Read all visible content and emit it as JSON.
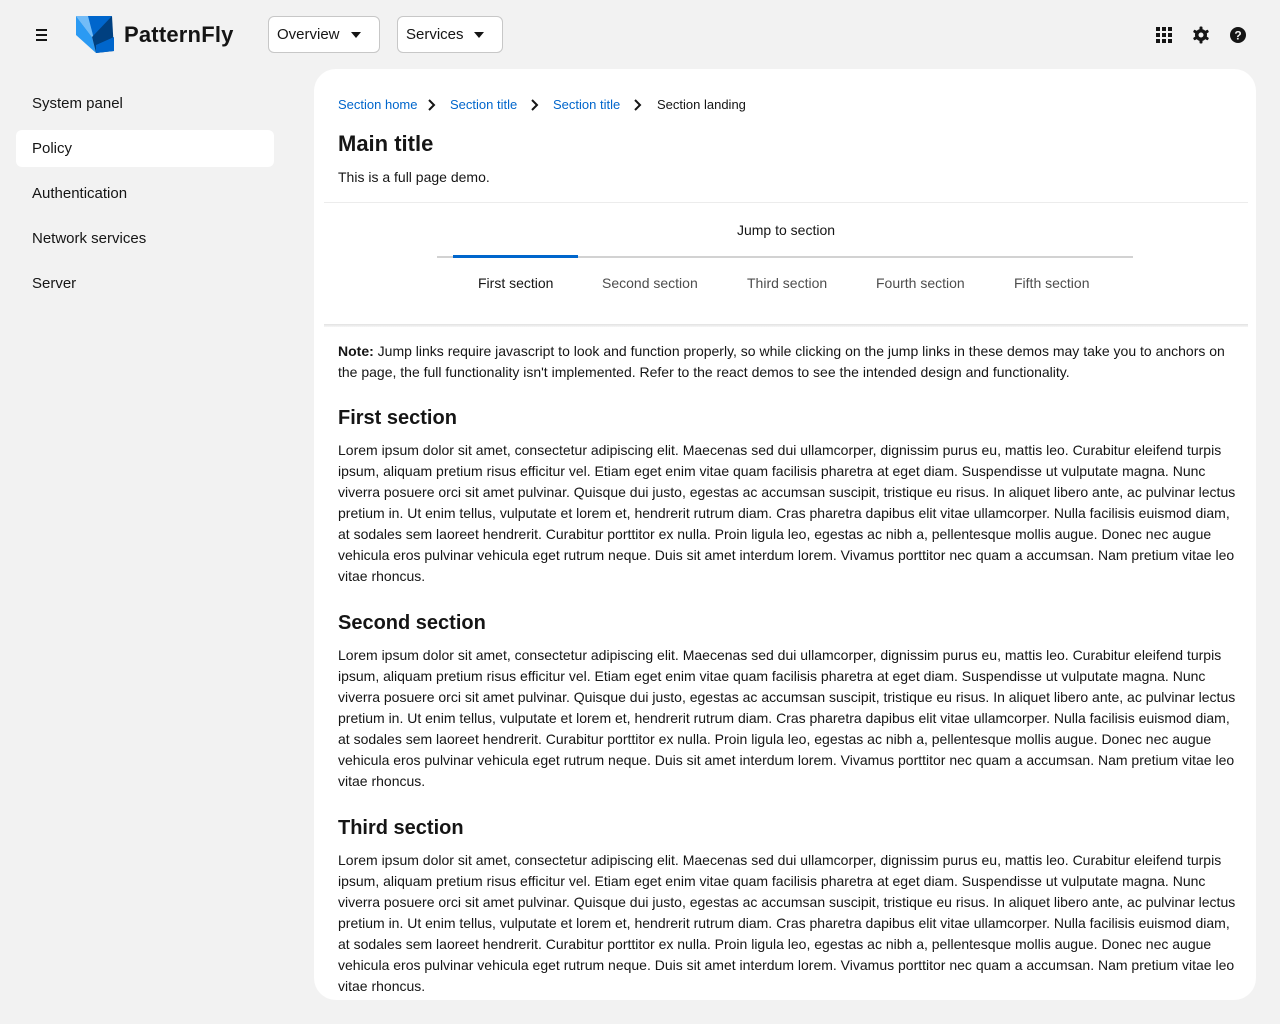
{
  "header": {
    "brand": "PatternFly",
    "selects": [
      {
        "label": "Overview"
      },
      {
        "label": "Services"
      }
    ],
    "icons": [
      "grid-icon",
      "gear-icon",
      "help-icon"
    ],
    "accent_color": "#0066cc"
  },
  "sidebar": {
    "items": [
      {
        "label": "System panel"
      },
      {
        "label": "Policy"
      },
      {
        "label": "Authentication"
      },
      {
        "label": "Network services"
      },
      {
        "label": "Server"
      }
    ],
    "active_index": 1
  },
  "breadcrumb": [
    {
      "label": "Section home"
    },
    {
      "label": "Section title"
    },
    {
      "label": "Section title"
    },
    {
      "label": "Section landing"
    }
  ],
  "page": {
    "title": "Main title",
    "subtitle": "This is a full page demo."
  },
  "jump_links": {
    "label": "Jump to section",
    "tabs": [
      {
        "label": "First section"
      },
      {
        "label": "Second section"
      },
      {
        "label": "Third section"
      },
      {
        "label": "Fourth section"
      },
      {
        "label": "Fifth section"
      }
    ],
    "active_index": 0
  },
  "note": {
    "prefix": "Note:",
    "text": " Jump links require javascript to look and function properly, so while clicking on the jump links in these demos may take you to anchors on the page, the full functionality isn't implemented. Refer to the react demos to see the intended design and functionality."
  },
  "sections": [
    {
      "title": "First section",
      "body": "Lorem ipsum dolor sit amet, consectetur adipiscing elit. Maecenas sed dui ullamcorper, dignissim purus eu, mattis leo. Curabitur eleifend turpis ipsum, aliquam pretium risus efficitur vel. Etiam eget enim vitae quam facilisis pharetra at eget diam. Suspendisse ut vulputate magna. Nunc viverra posuere orci sit amet pulvinar. Quisque dui justo, egestas ac accumsan suscipit, tristique eu risus. In aliquet libero ante, ac pulvinar lectus pretium in. Ut enim tellus, vulputate et lorem et, hendrerit rutrum diam. Cras pharetra dapibus elit vitae ullamcorper. Nulla facilisis euismod diam, at sodales sem laoreet hendrerit. Curabitur porttitor ex nulla. Proin ligula leo, egestas ac nibh a, pellentesque mollis augue. Donec nec augue vehicula eros pulvinar vehicula eget rutrum neque. Duis sit amet interdum lorem. Vivamus porttitor nec quam a accumsan. Nam pretium vitae leo vitae rhoncus."
    },
    {
      "title": "Second section",
      "body": "Lorem ipsum dolor sit amet, consectetur adipiscing elit. Maecenas sed dui ullamcorper, dignissim purus eu, mattis leo. Curabitur eleifend turpis ipsum, aliquam pretium risus efficitur vel. Etiam eget enim vitae quam facilisis pharetra at eget diam. Suspendisse ut vulputate magna. Nunc viverra posuere orci sit amet pulvinar. Quisque dui justo, egestas ac accumsan suscipit, tristique eu risus. In aliquet libero ante, ac pulvinar lectus pretium in. Ut enim tellus, vulputate et lorem et, hendrerit rutrum diam. Cras pharetra dapibus elit vitae ullamcorper. Nulla facilisis euismod diam, at sodales sem laoreet hendrerit. Curabitur porttitor ex nulla. Proin ligula leo, egestas ac nibh a, pellentesque mollis augue. Donec nec augue vehicula eros pulvinar vehicula eget rutrum neque. Duis sit amet interdum lorem. Vivamus porttitor nec quam a accumsan. Nam pretium vitae leo vitae rhoncus."
    },
    {
      "title": "Third section",
      "body": "Lorem ipsum dolor sit amet, consectetur adipiscing elit. Maecenas sed dui ullamcorper, dignissim purus eu, mattis leo. Curabitur eleifend turpis ipsum, aliquam pretium risus efficitur vel. Etiam eget enim vitae quam facilisis pharetra at eget diam. Suspendisse ut vulputate magna. Nunc viverra posuere orci sit amet pulvinar. Quisque dui justo, egestas ac accumsan suscipit, tristique eu risus. In aliquet libero ante, ac pulvinar lectus pretium in. Ut enim tellus, vulputate et lorem et, hendrerit rutrum diam. Cras pharetra dapibus elit vitae ullamcorper. Nulla facilisis euismod diam, at sodales sem laoreet hendrerit. Curabitur porttitor ex nulla. Proin ligula leo, egestas ac nibh a, pellentesque mollis augue. Donec nec augue vehicula eros pulvinar vehicula eget rutrum neque. Duis sit amet interdum lorem. Vivamus porttitor nec quam a accumsan. Nam pretium vitae leo vitae rhoncus."
    }
  ]
}
